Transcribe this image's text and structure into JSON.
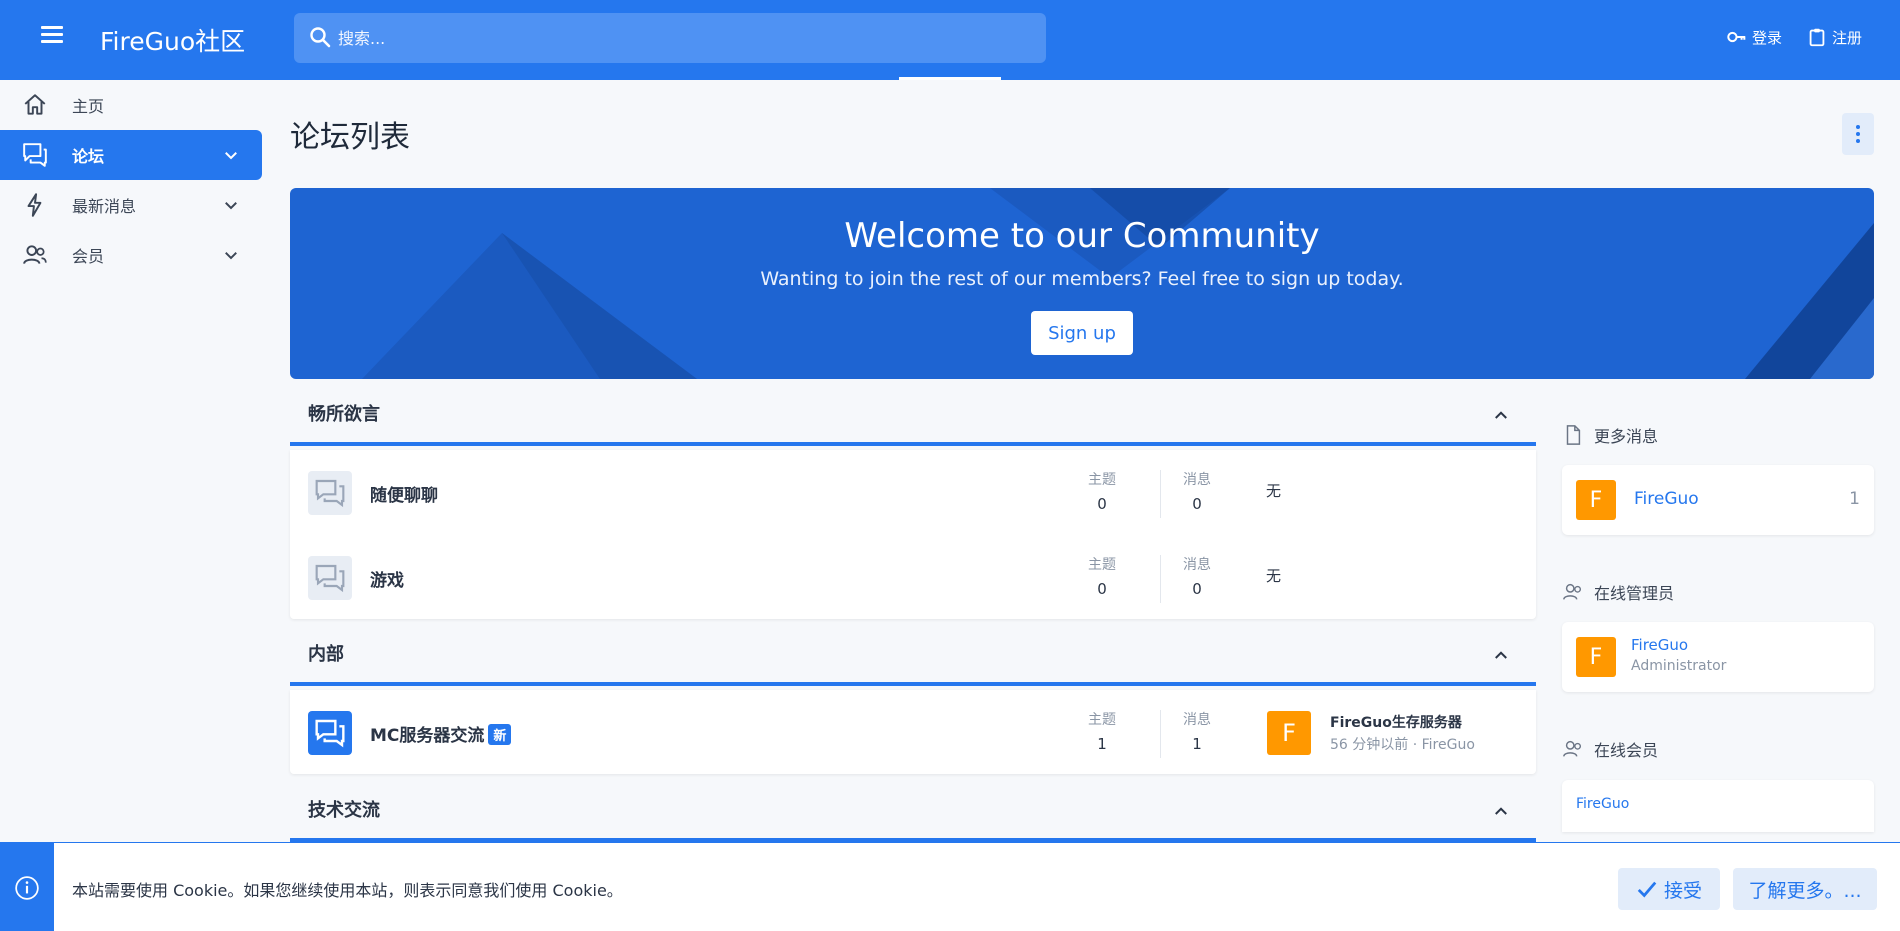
{
  "header": {
    "brand": "FireGuo社区",
    "search_placeholder": "搜索...",
    "login": "登录",
    "register": "注册"
  },
  "sidebar": {
    "items": [
      {
        "label": "主页",
        "icon": "home-icon"
      },
      {
        "label": "论坛",
        "icon": "forum-icon",
        "active": true
      },
      {
        "label": "最新消息",
        "icon": "bolt-icon"
      },
      {
        "label": "会员",
        "icon": "users-icon"
      }
    ]
  },
  "main": {
    "title": "论坛列表",
    "banner": {
      "title": "Welcome to our Community",
      "subtitle": "Wanting to join the rest of our members? Feel free to sign up today.",
      "signup": "Sign up"
    },
    "stat_labels": {
      "threads": "主题",
      "messages": "消息"
    },
    "categories": [
      {
        "title": "畅所欲言",
        "nodes": [
          {
            "title": "随便聊聊",
            "threads": "0",
            "messages": "0",
            "last": "无"
          },
          {
            "title": "游戏",
            "threads": "0",
            "messages": "0",
            "last": "无"
          }
        ]
      },
      {
        "title": "内部",
        "nodes": [
          {
            "title": "MC服务器交流",
            "badge": "新",
            "threads": "1",
            "messages": "1",
            "last_avatar": "F",
            "last_title": "FireGuo生存服务器",
            "last_meta": "56 分钟以前 · FireGuo"
          }
        ]
      },
      {
        "title": "技术交流"
      }
    ]
  },
  "right": {
    "more_news": {
      "title": "更多消息",
      "user": "FireGuo",
      "avatar": "F",
      "count": "1"
    },
    "staff": {
      "title": "在线管理员",
      "user": "FireGuo",
      "role": "Administrator",
      "avatar": "F"
    },
    "members": {
      "title": "在线会员",
      "user": "FireGuo"
    }
  },
  "cookie": {
    "text": "本站需要使用 Cookie。如果您继续使用本站，则表示同意我们使用 Cookie。",
    "accept": "接受",
    "learn_more": "了解更多。..."
  },
  "colors": {
    "accent": "#2577ee",
    "avatar": "#ff9800"
  }
}
